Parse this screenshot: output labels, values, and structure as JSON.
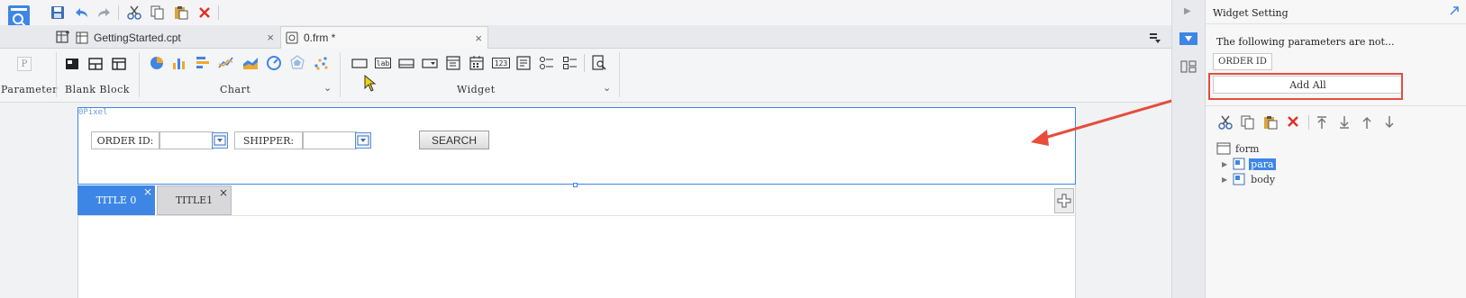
{
  "toolbar": {
    "icons": [
      "save-icon",
      "undo-icon",
      "redo-icon",
      "cut-icon",
      "copy-icon",
      "paste-icon",
      "delete-icon"
    ]
  },
  "tabs": [
    {
      "label": "GettingStarted.cpt",
      "close": "×"
    },
    {
      "label": "0.frm *",
      "close": "×"
    }
  ],
  "ribbon": {
    "parameter_label": "Parameter",
    "blank_block_label": "Blank Block",
    "chart_label": "Chart",
    "widget_label": "Widget",
    "parameter_glyph": "P",
    "widget_glyph_lab": "lab",
    "widget_glyph_num": "123"
  },
  "canvas": {
    "para_tag": "0Pixel",
    "order_label": "ORDER ID:",
    "shipper_label": "SHIPPER:",
    "search_label": "SEARCH",
    "content_tabs": [
      {
        "label": "TITLE 0",
        "close": "×"
      },
      {
        "label": "TITLE1",
        "close": "×"
      }
    ],
    "add_tab": "+"
  },
  "panel": {
    "title": "Widget Setting",
    "notice": "The following parameters are not...",
    "param_name": "ORDER ID",
    "add_all_label": "Add All",
    "tree": {
      "root": "form",
      "children": [
        {
          "label": "para"
        },
        {
          "label": "body"
        }
      ]
    }
  },
  "colors": {
    "accent": "#3d86e6",
    "highlight": "#e74c3c",
    "tab_active": "#3d86e6"
  }
}
